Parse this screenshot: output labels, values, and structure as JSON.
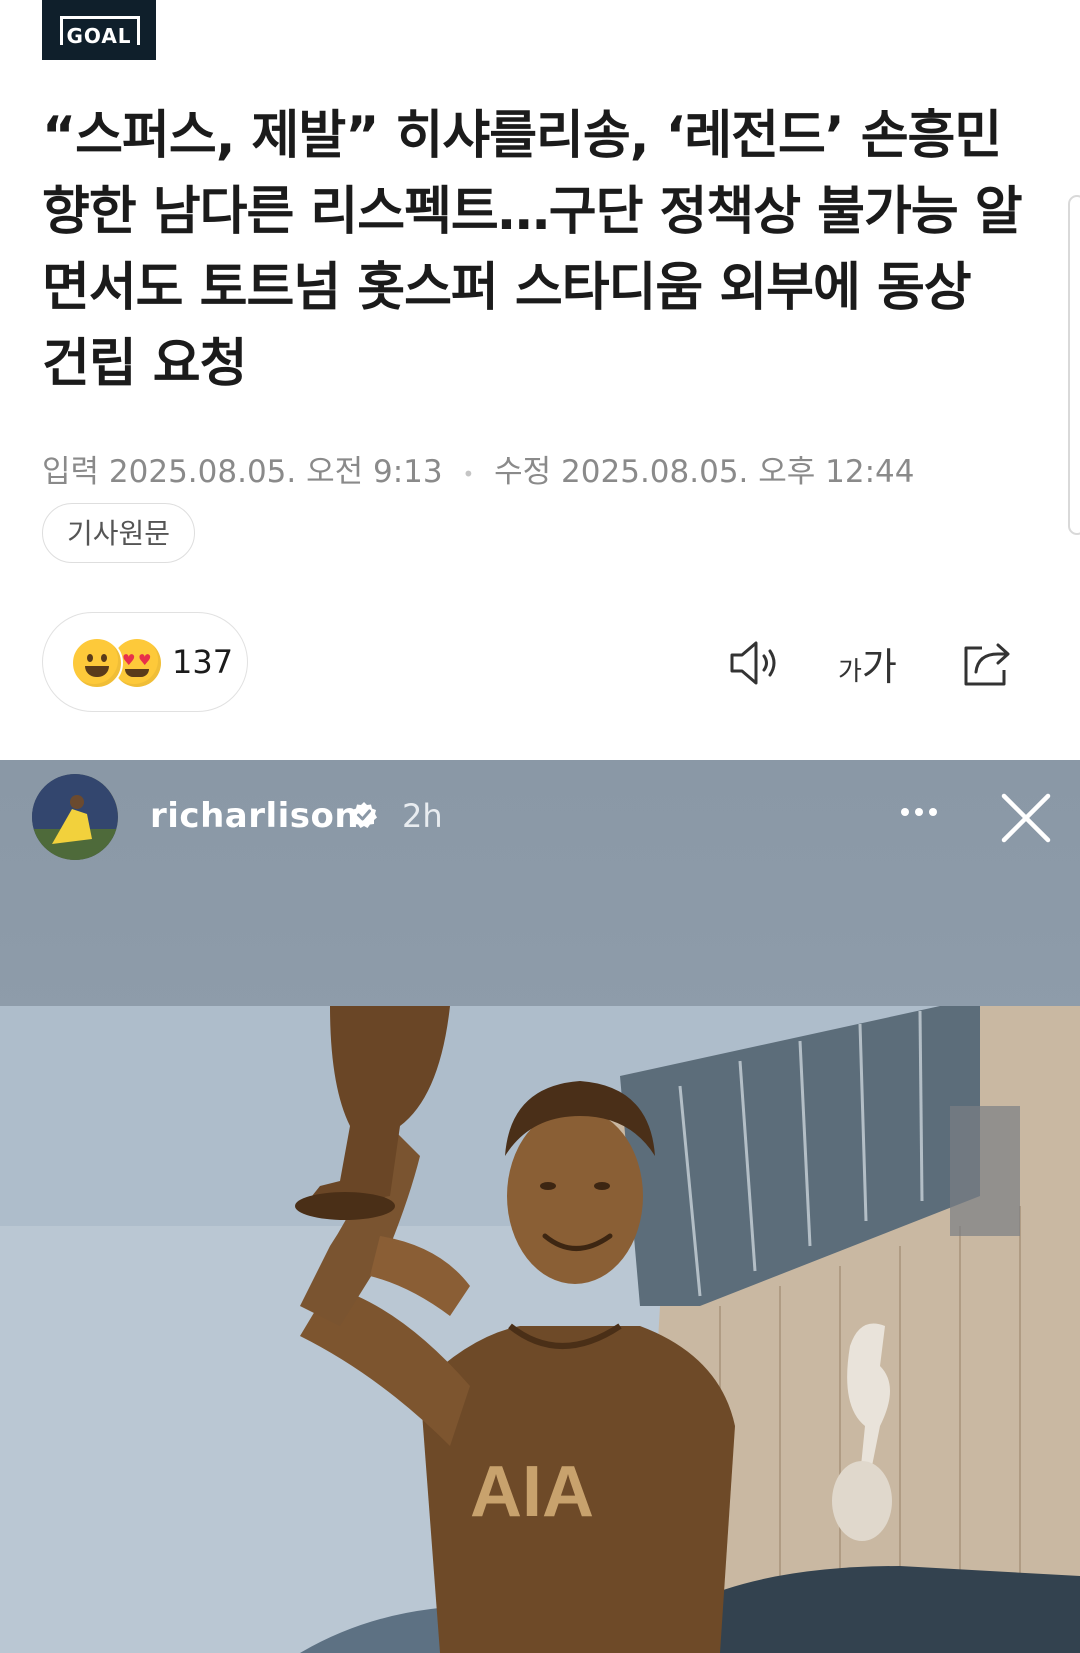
{
  "publisher": {
    "logo_text": "GOAL"
  },
  "article": {
    "headline": "“스퍼스, 제발” 히샤를리송, ‘레전드’ 손흥민 향한 남다른 리스펙트…구단 정책상 불가능 알면서도 토트넘 홋스퍼 스타디움 외부에 동상 건립 요청",
    "input_label": "입력",
    "input_datetime": "2025.08.05. 오전 9:13",
    "modified_label": "수정",
    "modified_datetime": "2025.08.05. 오후 12:44",
    "original_button": "기사원문"
  },
  "reactions": {
    "count": "137",
    "icons": [
      "smiling-face-icon",
      "heart-eyes-icon"
    ]
  },
  "toolbar": {
    "font_small": "가",
    "font_large": "가",
    "icons": [
      "speaker-icon",
      "font-size-icon",
      "share-icon"
    ]
  },
  "story": {
    "username": "richarlison",
    "time": "2h",
    "verified": true,
    "image_overlay_text": "AIA",
    "colors": {
      "header_bg": "#8a98a6",
      "text": "#ffffff",
      "bronze": "#7a5430",
      "sky": "#b9c6d2"
    }
  }
}
